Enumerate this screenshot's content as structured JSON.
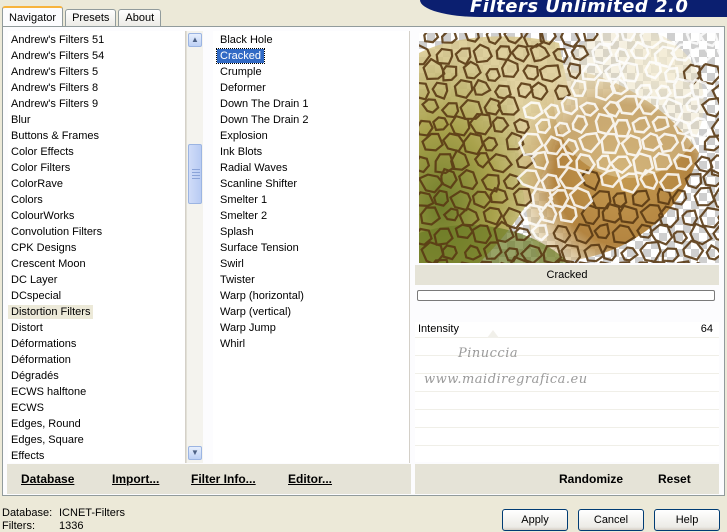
{
  "tabs": [
    "Navigator",
    "Presets",
    "About"
  ],
  "banner_title": "Filters Unlimited 2.0",
  "categories": [
    "Andrew's Filters 51",
    "Andrew's Filters 54",
    "Andrew's Filters 5",
    "Andrew's Filters 8",
    "Andrew's Filters 9",
    "Blur",
    "Buttons & Frames",
    "Color Effects",
    "Color Filters",
    "ColorRave",
    "Colors",
    "ColourWorks",
    "Convolution Filters",
    "CPK Designs",
    "Crescent Moon",
    "DC Layer",
    "DCspecial",
    "Distortion Filters",
    "Distort",
    "Déformations",
    "Déformation",
    "Dégradés",
    "ECWS halftone",
    "ECWS",
    "Edges, Round",
    "Edges, Square",
    "Effects"
  ],
  "selected_category": "Distortion Filters",
  "filters": [
    "Black Hole",
    "Cracked",
    "Crumple",
    "Deformer",
    "Down The Drain 1",
    "Down The Drain 2",
    "Explosion",
    "Ink Blots",
    "Radial Waves",
    "Scanline Shifter",
    "Smelter 1",
    "Smelter 2",
    "Splash",
    "Surface Tension",
    "Swirl",
    "Twister",
    "Warp (horizontal)",
    "Warp (vertical)",
    "Warp Jump",
    "Whirl"
  ],
  "selected_filter": "Cracked",
  "preview": {
    "filter_name": "Cracked",
    "progress_percent": 0
  },
  "parameters": [
    {
      "name": "Intensity",
      "value": "64",
      "level": 0.25
    }
  ],
  "watermark": {
    "line1": "Pinuccia",
    "line2": "www.maidiregrafica.eu"
  },
  "bottom_left_buttons": {
    "database": "Database",
    "import": "Import...",
    "filter_info": "Filter Info...",
    "editor": "Editor..."
  },
  "bottom_right_buttons": {
    "randomize": "Randomize",
    "reset": "Reset"
  },
  "status": {
    "database_label": "Database:",
    "database_value": "ICNET-Filters",
    "filters_label": "Filters:",
    "filters_value": "1336"
  },
  "dialog_buttons": {
    "apply": "Apply",
    "cancel": "Cancel",
    "help": "Help"
  }
}
